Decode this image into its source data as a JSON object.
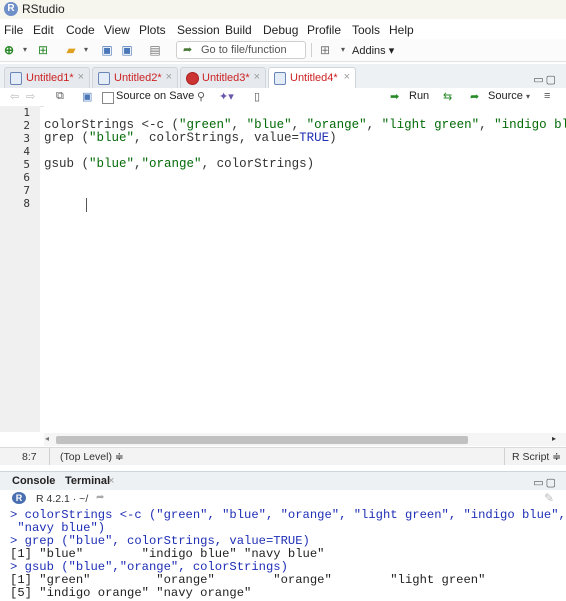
{
  "app": {
    "logo": "R",
    "title": "RStudio"
  },
  "menu": [
    "File",
    "Edit",
    "Code",
    "View",
    "Plots",
    "Session",
    "Build",
    "Debug",
    "Profile",
    "Tools",
    "Help"
  ],
  "toolbar": {
    "goto_placeholder": "Go to file/function",
    "addins_label": "Addins",
    "addins_caret": "▾"
  },
  "tabs": [
    {
      "label": "Untitled1*",
      "icon": "r-script-icon"
    },
    {
      "label": "Untitled2*",
      "icon": "r-script-icon"
    },
    {
      "label": "Untitled3*",
      "icon": "red-stop-icon"
    },
    {
      "label": "Untitled4*",
      "icon": "r-script-icon",
      "active": true
    }
  ],
  "editor_toolbar": {
    "source_on_save": "Source on Save",
    "run": "Run",
    "source": "Source"
  },
  "line_numbers": [
    "1",
    "2",
    "3",
    "4",
    "5",
    "6",
    "7",
    "8"
  ],
  "code": {
    "line2": {
      "pre": "colorStrings <-c (",
      "s1": "\"green\"",
      "c1": ", ",
      "s2": "\"blue\"",
      "c2": ", ",
      "s3": "\"orange\"",
      "c3": ", ",
      "s4": "\"light green\"",
      "c4": ", ",
      "s5": "\"indigo blue\"",
      "post": ","
    },
    "line3": {
      "pre": "grep (",
      "s1": "\"blue\"",
      "mid": ", colorStrings, value=",
      "kw": "TRUE",
      "post": ")"
    },
    "line5": {
      "pre": "gsub (",
      "s1": "\"blue\"",
      "c1": ",",
      "s2": "\"orange\"",
      "post": ", colorStrings)"
    }
  },
  "status": {
    "position": "8:7",
    "scope": "(Top Level) ≑",
    "file_type": "R Script ≑"
  },
  "console_tabs": {
    "console": "Console",
    "terminal": "Terminal",
    "terminal_close": "×"
  },
  "console_info": {
    "version": "R 4.2.1 · ~/"
  },
  "console_lines": [
    "> colorStrings <-c (\"green\", \"blue\", \"orange\", \"light green\", \"indigo blue\",",
    " \"navy blue\")",
    "> grep (\"blue\", colorStrings, value=TRUE)",
    "[1] \"blue\"        \"indigo blue\" \"navy blue\"",
    "> gsub (\"blue\",\"orange\", colorStrings)",
    "[1] \"green\"         \"orange\"        \"orange\"        \"light green\"",
    "[5] \"indigo orange\" \"navy orange\""
  ]
}
